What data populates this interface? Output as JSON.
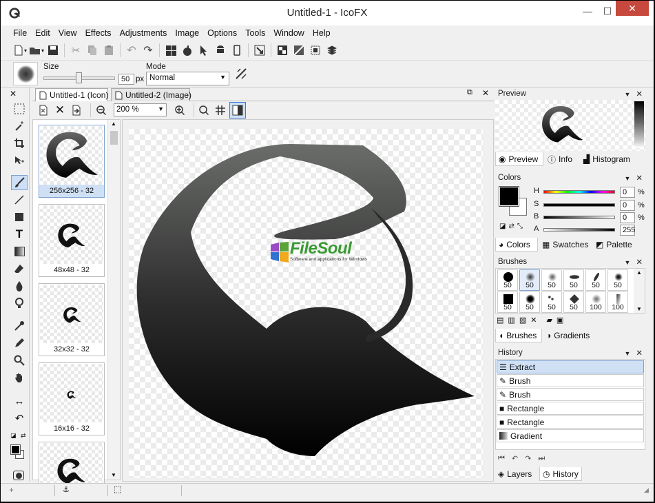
{
  "window": {
    "title": "Untitled-1 - IcoFX"
  },
  "menu": [
    "File",
    "Edit",
    "View",
    "Effects",
    "Adjustments",
    "Image",
    "Options",
    "Tools",
    "Window",
    "Help"
  ],
  "options": {
    "size_label": "Size",
    "size_value": "50",
    "size_unit": "px",
    "mode_label": "Mode",
    "mode_value": "Normal"
  },
  "doc_tabs": [
    {
      "label": "Untitled-1 (Icon)"
    },
    {
      "label": "Untitled-2 (Image)"
    }
  ],
  "zoom": "200 %",
  "thumbs": [
    {
      "label": "256x256 - 32"
    },
    {
      "label": "48x48 - 32"
    },
    {
      "label": "32x32 - 32"
    },
    {
      "label": "16x16 - 32"
    }
  ],
  "watermark": {
    "brand": "FileSoul",
    "tagline": "Software and applications for Windows"
  },
  "preview": {
    "title": "Preview",
    "tabs": [
      "Preview",
      "Info",
      "Histogram"
    ]
  },
  "colors": {
    "title": "Colors",
    "rows": [
      {
        "label": "H",
        "value": "0",
        "unit": "%"
      },
      {
        "label": "S",
        "value": "0",
        "unit": "%"
      },
      {
        "label": "B",
        "value": "0",
        "unit": "%"
      },
      {
        "label": "A",
        "value": "255",
        "unit": ""
      }
    ],
    "tabs": [
      "Colors",
      "Swatches",
      "Palette"
    ]
  },
  "brushes": {
    "title": "Brushes",
    "sizes": [
      "50",
      "50",
      "50",
      "50",
      "50",
      "50",
      "50",
      "50",
      "50",
      "50",
      "100",
      "100"
    ],
    "tabs": [
      "Brushes",
      "Gradients"
    ]
  },
  "history": {
    "title": "History",
    "items": [
      "Extract",
      "Brush",
      "Brush",
      "Rectangle",
      "Rectangle",
      "Gradient"
    ],
    "tabs": [
      "Layers",
      "History"
    ]
  }
}
